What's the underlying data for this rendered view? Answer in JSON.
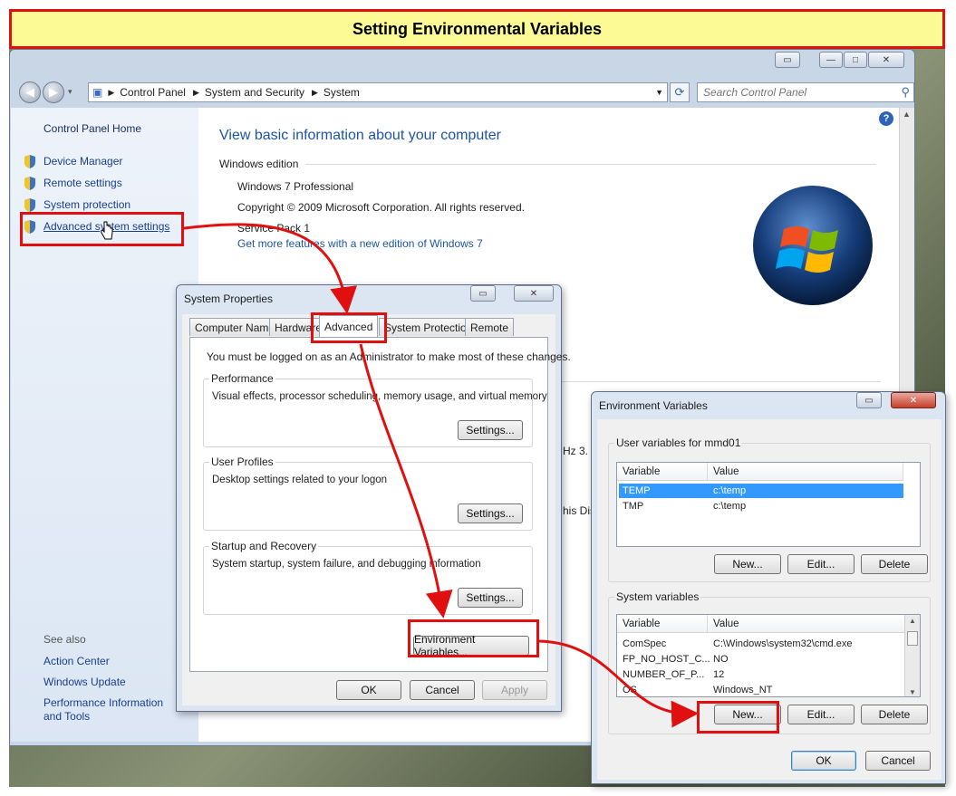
{
  "banner": {
    "title": "Setting Environmental Variables"
  },
  "explorer": {
    "breadcrumbs": [
      "Control Panel",
      "System and Security",
      "System"
    ],
    "search_placeholder": "Search Control Panel"
  },
  "sidebar": {
    "home": "Control Panel Home",
    "links": [
      "Device Manager",
      "Remote settings",
      "System protection",
      "Advanced system settings"
    ],
    "see_also_heading": "See also",
    "see_also": [
      "Action Center",
      "Windows Update",
      "Performance Information and Tools"
    ]
  },
  "main": {
    "heading": "View basic information about your computer",
    "section": "Windows edition",
    "edition": "Windows 7 Professional",
    "copyright": "Copyright © 2009 Microsoft Corporation.  All rights reserved.",
    "service_pack": "Service Pack 1",
    "upgrade_link": "Get more features with a new edition of Windows 7",
    "partial_ghz": "Hz  3.",
    "partial_disk": "his Dis"
  },
  "system_properties": {
    "title": "System Properties",
    "tabs": [
      "Computer Name",
      "Hardware",
      "Advanced",
      "System Protection",
      "Remote"
    ],
    "active_tab": "Advanced",
    "admin_note": "You must be logged on as an Administrator to make most of these changes.",
    "groups": [
      {
        "label": "Performance",
        "desc": "Visual effects, processor scheduling, memory usage, and virtual memory",
        "button": "Settings..."
      },
      {
        "label": "User Profiles",
        "desc": "Desktop settings related to your logon",
        "button": "Settings..."
      },
      {
        "label": "Startup and Recovery",
        "desc": "System startup, system failure, and debugging information",
        "button": "Settings..."
      }
    ],
    "env_button": "Environment Variables...",
    "ok": "OK",
    "cancel": "Cancel",
    "apply": "Apply"
  },
  "env_vars": {
    "title": "Environment Variables",
    "user_label": "User variables for mmd01",
    "col_variable": "Variable",
    "col_value": "Value",
    "user_rows": [
      {
        "name": "TEMP",
        "value": "c:\\temp"
      },
      {
        "name": "TMP",
        "value": "c:\\temp"
      }
    ],
    "system_label": "System variables",
    "system_rows": [
      {
        "name": "ComSpec",
        "value": "C:\\Windows\\system32\\cmd.exe"
      },
      {
        "name": "FP_NO_HOST_C...",
        "value": "NO"
      },
      {
        "name": "NUMBER_OF_P...",
        "value": "12"
      },
      {
        "name": "OS",
        "value": "Windows_NT"
      }
    ],
    "new": "New...",
    "edit": "Edit...",
    "delete": "Delete",
    "ok": "OK",
    "cancel": "Cancel"
  },
  "colors": {
    "highlight": "#e01010",
    "banner": "#fbfa95",
    "link": "#1a3e8a",
    "selection": "#3399ff"
  }
}
